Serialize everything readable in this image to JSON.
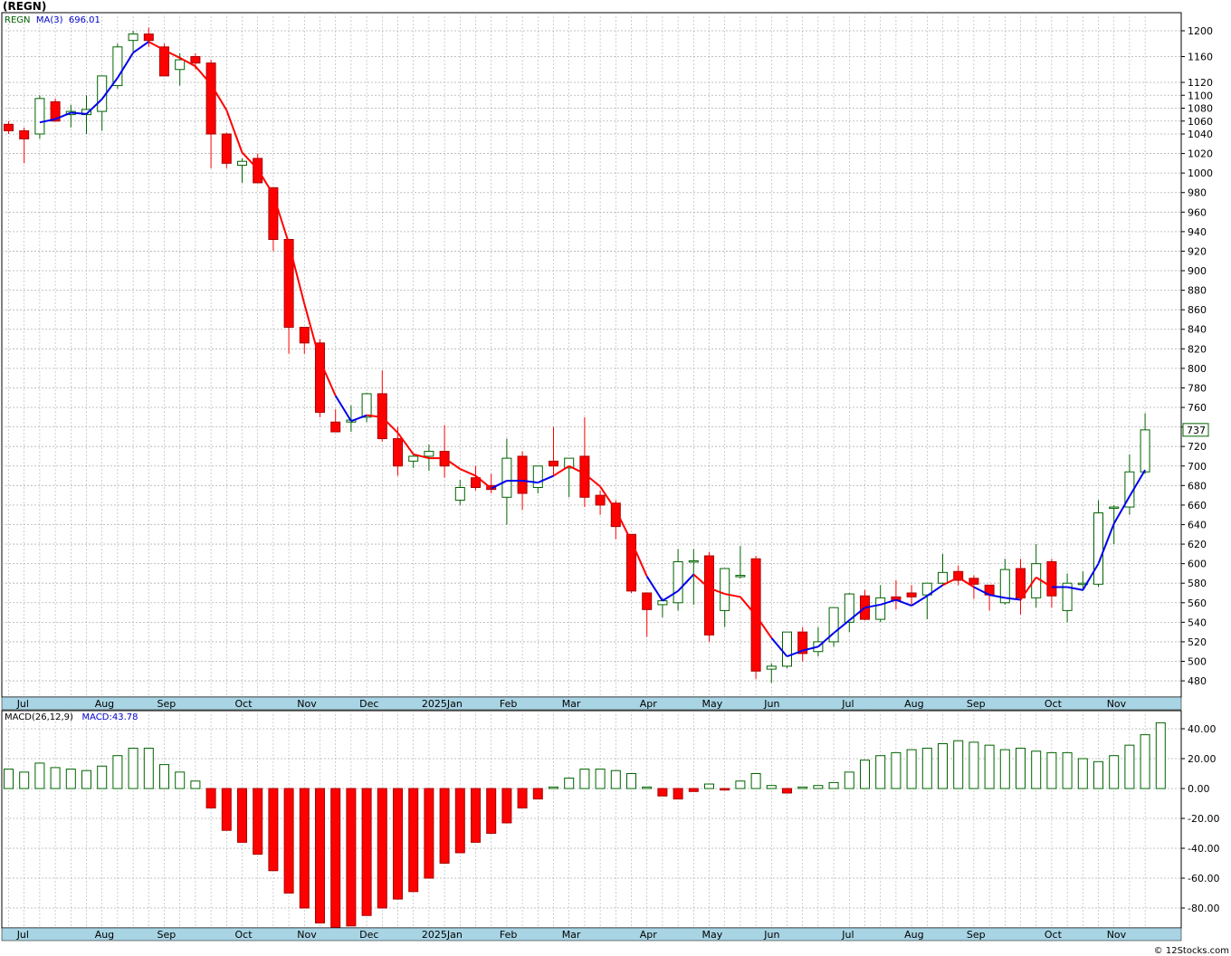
{
  "header": {
    "ticker_title": "(REGN)"
  },
  "price_legend": {
    "symbol": "REGN",
    "ma_label": "MA(3)",
    "ma_value": "696.01"
  },
  "macd_legend": {
    "label": "MACD(26,12,9)",
    "macd_label": "MACD:",
    "macd_value": "43.78"
  },
  "last_price_tag": "737",
  "credit": "© 12Stocks.com",
  "colors": {
    "up": "#006400",
    "down": "#ff0000",
    "ma_up": "#0000ee",
    "ma_down": "#ff0000",
    "grid": "#b0b0b0",
    "axis_band": "#a8d4e4",
    "background": "#ffffff"
  },
  "chart_data": [
    {
      "type": "candlestick",
      "title": "(REGN)",
      "timeframe": "weekly",
      "ylim": [
        470,
        1210
      ],
      "y_ticks": [
        480,
        500,
        520,
        540,
        560,
        580,
        600,
        620,
        640,
        660,
        680,
        700,
        720,
        740,
        760,
        780,
        800,
        820,
        840,
        860,
        880,
        900,
        920,
        940,
        960,
        980,
        1000,
        1020,
        1040,
        1060,
        1080,
        1100,
        1120,
        1160,
        1200
      ],
      "x_month_labels": [
        "Jul",
        "Aug",
        "Sep",
        "Oct",
        "Nov",
        "Dec",
        "2025Jan",
        "Feb",
        "Mar",
        "Apr",
        "May",
        "Jun",
        "Jul",
        "Aug",
        "Sep",
        "Oct",
        "Nov"
      ],
      "month_label_week_index": [
        1,
        6,
        10,
        15,
        19,
        23,
        27,
        32,
        36,
        41,
        45,
        49,
        54,
        58,
        62,
        67,
        71
      ],
      "candles_ohlc": [
        [
          1055,
          1060,
          1040,
          1045
        ],
        [
          1045,
          1050,
          1010,
          1035
        ],
        [
          1040,
          1100,
          1035,
          1095
        ],
        [
          1090,
          1095,
          1060,
          1060
        ],
        [
          1070,
          1085,
          1050,
          1075
        ],
        [
          1070,
          1100,
          1040,
          1078
        ],
        [
          1075,
          1130,
          1045,
          1130
        ],
        [
          1115,
          1180,
          1110,
          1175
        ],
        [
          1185,
          1200,
          1165,
          1195
        ],
        [
          1195,
          1205,
          1175,
          1185
        ],
        [
          1175,
          1180,
          1130,
          1130
        ],
        [
          1140,
          1165,
          1115,
          1155
        ],
        [
          1160,
          1165,
          1140,
          1150
        ],
        [
          1150,
          1155,
          1005,
          1040
        ],
        [
          1040,
          1042,
          1005,
          1010
        ],
        [
          1008,
          1015,
          990,
          1012
        ],
        [
          1015,
          1020,
          990,
          990
        ],
        [
          985,
          985,
          920,
          932
        ],
        [
          932,
          932,
          815,
          842
        ],
        [
          842,
          842,
          815,
          826
        ],
        [
          826,
          830,
          750,
          755
        ],
        [
          745,
          758,
          735,
          735
        ],
        [
          745,
          762,
          735,
          747
        ],
        [
          750,
          775,
          745,
          774
        ],
        [
          774,
          798,
          725,
          728
        ],
        [
          728,
          740,
          690,
          700
        ],
        [
          705,
          712,
          698,
          710
        ],
        [
          710,
          722,
          695,
          715
        ],
        [
          715,
          742,
          688,
          700
        ],
        [
          665,
          686,
          660,
          678
        ],
        [
          688,
          700,
          675,
          678
        ],
        [
          680,
          692,
          672,
          676
        ],
        [
          668,
          728,
          640,
          708
        ],
        [
          710,
          715,
          655,
          672
        ],
        [
          678,
          700,
          672,
          700
        ],
        [
          705,
          740,
          690,
          700
        ],
        [
          698,
          708,
          668,
          708
        ],
        [
          710,
          750,
          658,
          668
        ],
        [
          670,
          675,
          650,
          660
        ],
        [
          662,
          665,
          625,
          638
        ],
        [
          630,
          630,
          570,
          572
        ],
        [
          570,
          570,
          525,
          553
        ],
        [
          558,
          565,
          545,
          562
        ],
        [
          560,
          615,
          552,
          602
        ],
        [
          602,
          615,
          558,
          603
        ],
        [
          608,
          612,
          520,
          527
        ],
        [
          552,
          595,
          535,
          595
        ],
        [
          588,
          618,
          585,
          588
        ],
        [
          605,
          608,
          482,
          490
        ],
        [
          492,
          498,
          478,
          495
        ],
        [
          495,
          530,
          493,
          530
        ],
        [
          530,
          535,
          500,
          508
        ],
        [
          510,
          535,
          505,
          520
        ],
        [
          520,
          555,
          515,
          555
        ],
        [
          540,
          570,
          530,
          569
        ],
        [
          567,
          573,
          542,
          543
        ],
        [
          543,
          578,
          540,
          565
        ],
        [
          566,
          583,
          553,
          562
        ],
        [
          570,
          578,
          558,
          566
        ],
        [
          568,
          580,
          543,
          580
        ],
        [
          580,
          610,
          578,
          591
        ],
        [
          592,
          598,
          578,
          583
        ],
        [
          585,
          588,
          564,
          579
        ],
        [
          578,
          578,
          552,
          568
        ],
        [
          560,
          605,
          558,
          594
        ],
        [
          595,
          605,
          548,
          565
        ],
        [
          565,
          620,
          555,
          600
        ],
        [
          602,
          605,
          555,
          567
        ],
        [
          552,
          590,
          540,
          580
        ],
        [
          580,
          592,
          572,
          580
        ],
        [
          579,
          665,
          576,
          652
        ],
        [
          658,
          660,
          620,
          658
        ],
        [
          658,
          712,
          650,
          694
        ],
        [
          694,
          754,
          692,
          737
        ]
      ],
      "ma3": [
        null,
        null,
        1058,
        1063,
        1073,
        1071,
        1094,
        1127,
        1166,
        1183,
        1170,
        1158,
        1145,
        1117,
        1077,
        1021,
        1004,
        978,
        928,
        866,
        808,
        772,
        746,
        752,
        750,
        734,
        712,
        708,
        708,
        697,
        690,
        677,
        685,
        685,
        683,
        690,
        700,
        692,
        679,
        655,
        623,
        587,
        562,
        572,
        589,
        575,
        569,
        566,
        547,
        524,
        505,
        511,
        515,
        529,
        542,
        555,
        558,
        563,
        557,
        567,
        578,
        586,
        576,
        568,
        565,
        563,
        586,
        576,
        576,
        573,
        600,
        641,
        669,
        696
      ],
      "ma3_color_by_week": [
        "b",
        "b",
        "b",
        "b",
        "b",
        "b",
        "b",
        "b",
        "b",
        "b",
        "r",
        "r",
        "r",
        "r",
        "r",
        "r",
        "r",
        "r",
        "r",
        "r",
        "r",
        "r",
        "b",
        "b",
        "r",
        "r",
        "r",
        "r",
        "r",
        "r",
        "r",
        "r",
        "b",
        "b",
        "b",
        "b",
        "r",
        "r",
        "r",
        "r",
        "r",
        "r",
        "b",
        "b",
        "b",
        "r",
        "r",
        "r",
        "r",
        "r",
        "b",
        "b",
        "b",
        "b",
        "b",
        "b",
        "b",
        "b",
        "b",
        "b",
        "b",
        "r",
        "r",
        "b",
        "b",
        "b",
        "r",
        "r",
        "b",
        "b",
        "b",
        "b",
        "b",
        "b"
      ],
      "last_value": 737
    },
    {
      "type": "bar",
      "title": "MACD(26,12,9)",
      "ylim": [
        -95,
        50
      ],
      "y_ticks": [
        40,
        20,
        0,
        -20,
        -40,
        -60,
        -80
      ],
      "y_tick_labels": [
        "40.00",
        "20.00",
        "0.00",
        "-20.00",
        "-40.00",
        "-60.00",
        "-80.00"
      ],
      "x_month_labels": [
        "Jul",
        "Aug",
        "Sep",
        "Oct",
        "Nov",
        "Dec",
        "2025Jan",
        "Feb",
        "Mar",
        "Apr",
        "May",
        "Jun",
        "Jul",
        "Aug",
        "Sep",
        "Oct",
        "Nov"
      ],
      "values": [
        13,
        11,
        17,
        14,
        13,
        12,
        15,
        22,
        27,
        27,
        16,
        11,
        5,
        -13,
        -28,
        -36,
        -44,
        -55,
        -70,
        -80,
        -90,
        -93,
        -92,
        -85,
        -80,
        -74,
        -69,
        -60,
        -50,
        -43,
        -36,
        -30,
        -23,
        -13,
        -7,
        1,
        7,
        13,
        13,
        12,
        10,
        1,
        -5,
        -7,
        -2,
        3,
        -1,
        5,
        10,
        2,
        -3,
        1,
        2,
        4,
        11,
        19,
        22,
        24,
        26,
        27,
        30,
        32,
        31,
        29,
        26,
        27,
        25,
        24,
        24,
        20,
        18,
        22,
        29,
        36,
        44
      ],
      "last_value": 43.78
    }
  ]
}
